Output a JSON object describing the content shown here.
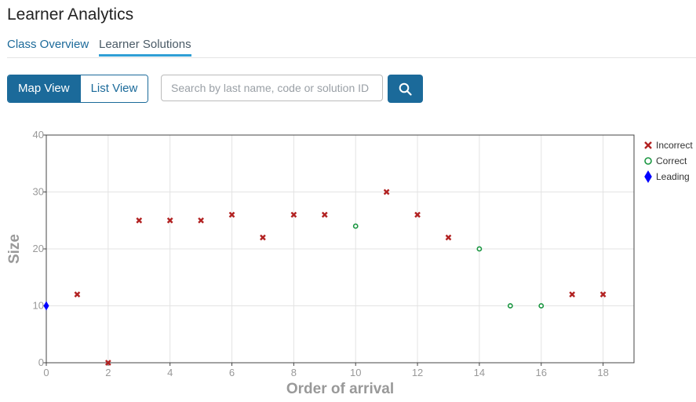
{
  "app": {
    "title": "Learner Analytics"
  },
  "tabs": [
    {
      "label": "Class Overview",
      "active": false
    },
    {
      "label": "Learner Solutions",
      "active": true
    }
  ],
  "view_toggle": {
    "map_label": "Map View",
    "list_label": "List View",
    "selected": "Map View"
  },
  "search": {
    "placeholder": "Search by last name, code or solution ID",
    "value": "",
    "button_icon": "search-icon"
  },
  "colors": {
    "primary": "#1b6a9a",
    "incorrect": "#b22222",
    "correct": "#1a9641",
    "leading": "#0000ff",
    "tab_underline": "#2f9fd5"
  },
  "chart_data": {
    "type": "scatter",
    "xlabel": "Order of arrival",
    "ylabel": "Size",
    "xlim": [
      0,
      19
    ],
    "ylim": [
      0,
      40
    ],
    "xticks": [
      0,
      2,
      4,
      6,
      8,
      10,
      12,
      14,
      16,
      18
    ],
    "yticks": [
      0,
      10,
      20,
      30,
      40
    ],
    "grid": true,
    "legend_position": "right",
    "series": [
      {
        "name": "Incorrect",
        "marker": "x",
        "color": "#b22222",
        "points": [
          [
            1,
            12
          ],
          [
            2,
            0
          ],
          [
            3,
            25
          ],
          [
            4,
            25
          ],
          [
            5,
            25
          ],
          [
            6,
            26
          ],
          [
            7,
            22
          ],
          [
            8,
            26
          ],
          [
            9,
            26
          ],
          [
            11,
            30
          ],
          [
            12,
            26
          ],
          [
            13,
            22
          ],
          [
            17,
            12
          ],
          [
            18,
            12
          ]
        ]
      },
      {
        "name": "Correct",
        "marker": "circle-open",
        "color": "#1a9641",
        "points": [
          [
            10,
            24
          ],
          [
            14,
            20
          ],
          [
            15,
            10
          ],
          [
            16,
            10
          ]
        ]
      },
      {
        "name": "Leading",
        "marker": "diamond",
        "color": "#0000ff",
        "points": [
          [
            0,
            10
          ]
        ]
      }
    ]
  }
}
